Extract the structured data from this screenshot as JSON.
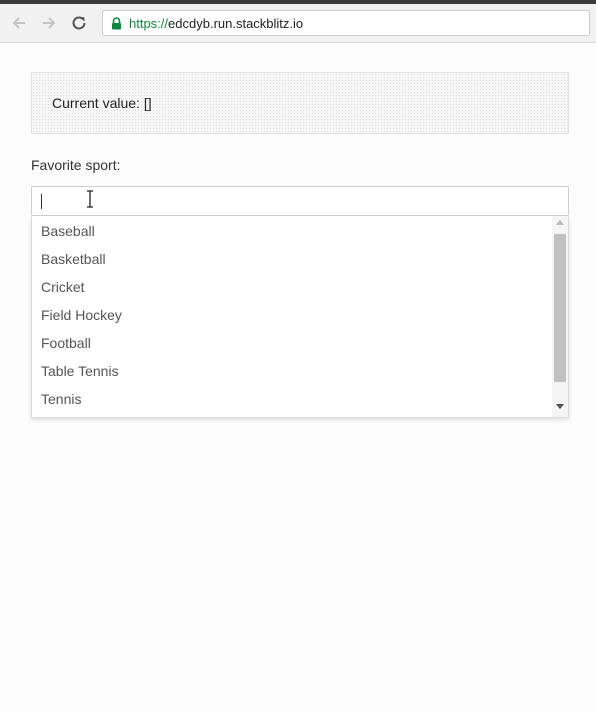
{
  "browser": {
    "url_scheme": "https://",
    "url_host": "edcdyb.run.stackblitz.io",
    "secure_color": "#0a8a3c",
    "icons": [
      "back-arrow-icon",
      "forward-arrow-icon",
      "reload-icon",
      "lock-icon"
    ]
  },
  "page": {
    "current_value_text": "Current value: []",
    "field_label": "Favorite sport:",
    "input_value": ""
  },
  "dropdown": {
    "options": [
      "Baseball",
      "Basketball",
      "Cricket",
      "Field Hockey",
      "Football",
      "Table Tennis",
      "Tennis"
    ]
  }
}
